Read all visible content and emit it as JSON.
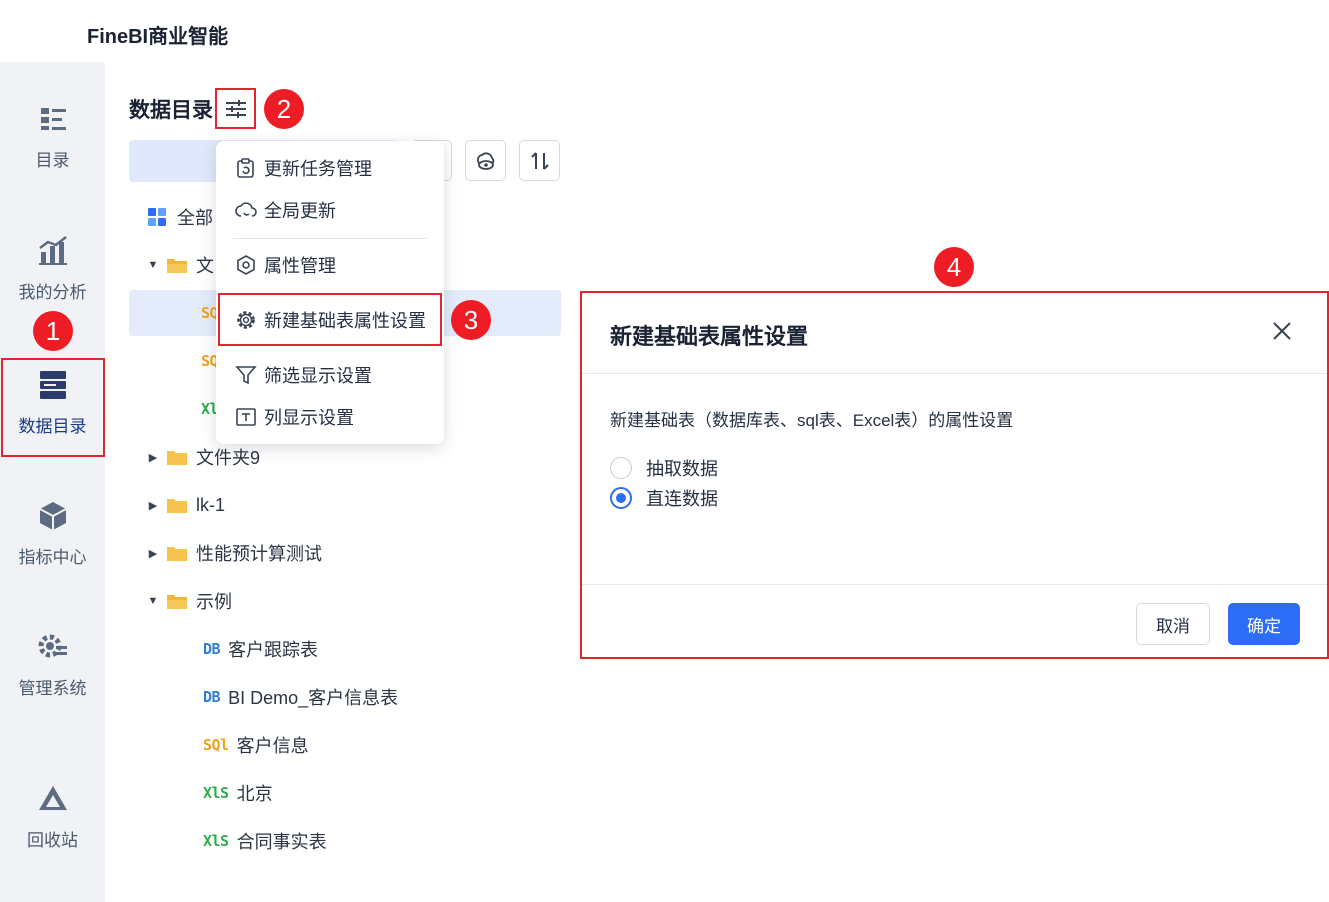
{
  "app": {
    "title": "FineBI商业智能"
  },
  "nav": {
    "items": [
      {
        "label": "目录",
        "icon": "list-icon"
      },
      {
        "label": "我的分析",
        "icon": "chart-icon"
      },
      {
        "label": "数据目录",
        "icon": "database-icon",
        "active": true
      },
      {
        "label": "指标中心",
        "icon": "cube-icon"
      },
      {
        "label": "管理系统",
        "icon": "settings-icon"
      },
      {
        "label": "回收站",
        "icon": "recycle-icon"
      }
    ]
  },
  "panel": {
    "title": "数据目录",
    "tree": [
      {
        "label": "全部",
        "type": "all"
      },
      {
        "label": "文",
        "type": "folder",
        "expanded": true
      },
      {
        "label": "",
        "type": "sql",
        "selected": true
      },
      {
        "label": "",
        "type": "sql"
      },
      {
        "label": "",
        "type": "xls"
      },
      {
        "label": "文件夹9",
        "type": "folder",
        "expanded": false
      },
      {
        "label": "lk-1",
        "type": "folder",
        "expanded": false
      },
      {
        "label": "性能预计算测试",
        "type": "folder",
        "expanded": false
      },
      {
        "label": "示例",
        "type": "folder",
        "expanded": true
      },
      {
        "label": "客户跟踪表",
        "type": "db"
      },
      {
        "label": "BI Demo_客户信息表",
        "type": "db"
      },
      {
        "label": "客户信息",
        "type": "sql"
      },
      {
        "label": "北京",
        "type": "xls"
      },
      {
        "label": "合同事实表",
        "type": "xls"
      }
    ],
    "type_labels": {
      "db": "DB",
      "sql": "SQl",
      "xls": "XlS"
    }
  },
  "dropdown": {
    "items": [
      {
        "label": "更新任务管理",
        "icon": "clipboard-refresh-icon"
      },
      {
        "label": "全局更新",
        "icon": "cloud-refresh-icon"
      },
      {
        "label": "属性管理",
        "icon": "hexagon-gear-icon"
      },
      {
        "label": "新建基础表属性设置",
        "icon": "gear-icon",
        "highlighted": true
      },
      {
        "label": "筛选显示设置",
        "icon": "filter-icon"
      },
      {
        "label": "列显示设置",
        "icon": "column-text-icon"
      }
    ]
  },
  "badges": {
    "b1": "1",
    "b2": "2",
    "b3": "3",
    "b4": "4"
  },
  "dialog": {
    "title": "新建基础表属性设置",
    "description": "新建基础表（数据库表、sql表、Excel表）的属性设置",
    "options": [
      {
        "label": "抽取数据",
        "checked": false
      },
      {
        "label": "直连数据",
        "checked": true
      }
    ],
    "cancel_label": "取消",
    "ok_label": "确定"
  },
  "colors": {
    "accent": "#2d6df6",
    "highlight": "#e0262e",
    "badge": "#ee1c25"
  }
}
